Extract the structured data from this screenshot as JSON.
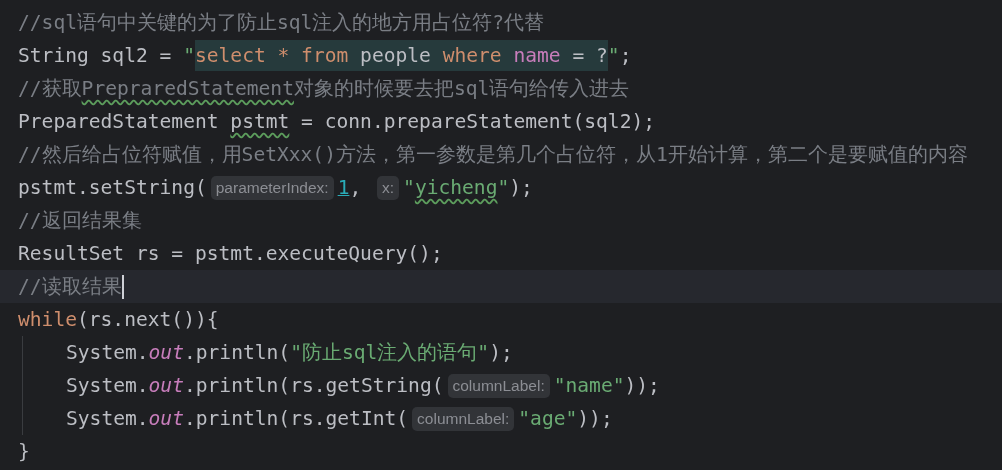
{
  "editor": {
    "lines": [
      {
        "current": false,
        "tokens": [
          {
            "kind": "comment",
            "text": "//sql语句中关键的为了防止sql注入的地方用占位符?代替"
          }
        ]
      },
      {
        "current": false,
        "tokens": [
          {
            "kind": "plain",
            "text": "String sql2 = "
          },
          {
            "kind": "string",
            "text": "\""
          },
          {
            "kind": "sql-keyword",
            "text": "select * from"
          },
          {
            "kind": "sql-plain",
            "text": " people "
          },
          {
            "kind": "sql-keyword",
            "text": "where "
          },
          {
            "kind": "sql-column",
            "text": "name"
          },
          {
            "kind": "sql-plain",
            "text": " = ?"
          },
          {
            "kind": "string",
            "text": "\""
          },
          {
            "kind": "plain",
            "text": ";"
          }
        ]
      },
      {
        "current": false,
        "tokens": [
          {
            "kind": "comment",
            "text": "//获取"
          },
          {
            "kind": "comment",
            "text": "PrepraredStatement",
            "typo": true
          },
          {
            "kind": "comment",
            "text": "对象的时候要去把sql语句给传入进去"
          }
        ]
      },
      {
        "current": false,
        "tokens": [
          {
            "kind": "plain",
            "text": "PreparedStatement "
          },
          {
            "kind": "plain",
            "text": "pstmt",
            "typo": true
          },
          {
            "kind": "plain",
            "text": " = conn.prepareStatement(sql2);"
          }
        ]
      },
      {
        "current": false,
        "tokens": [
          {
            "kind": "comment",
            "text": "//然后给占位符赋值，用SetXxx()方法，第一参数是第几个占位符，从1开始计算，第二个是要赋值的内容"
          }
        ]
      },
      {
        "current": false,
        "tokens": [
          {
            "kind": "plain",
            "text": "pstmt.setString("
          },
          {
            "kind": "hint",
            "text": "parameterIndex:"
          },
          {
            "kind": "number",
            "text": "1"
          },
          {
            "kind": "plain",
            "text": ", "
          },
          {
            "kind": "hint",
            "text": "x:"
          },
          {
            "kind": "string",
            "text": "\""
          },
          {
            "kind": "string",
            "text": "yicheng",
            "typo": true
          },
          {
            "kind": "string",
            "text": "\""
          },
          {
            "kind": "plain",
            "text": ");"
          }
        ]
      },
      {
        "current": false,
        "tokens": [
          {
            "kind": "comment",
            "text": "//返回结果集"
          }
        ]
      },
      {
        "current": false,
        "tokens": [
          {
            "kind": "plain",
            "text": "ResultSet rs = pstmt.executeQuery();"
          }
        ]
      },
      {
        "current": true,
        "tokens": [
          {
            "kind": "comment",
            "text": "//读取结果"
          }
        ]
      },
      {
        "current": false,
        "tokens": [
          {
            "kind": "keyword",
            "text": "while"
          },
          {
            "kind": "plain",
            "text": "(rs.next()){"
          }
        ],
        "children": [
          {
            "current": false,
            "tokens": [
              {
                "kind": "plain",
                "text": "System."
              },
              {
                "kind": "field",
                "text": "out"
              },
              {
                "kind": "plain",
                "text": ".println("
              },
              {
                "kind": "string",
                "text": "\"防止sql注入的语句\""
              },
              {
                "kind": "plain",
                "text": ");"
              }
            ]
          },
          {
            "current": false,
            "tokens": [
              {
                "kind": "plain",
                "text": "System."
              },
              {
                "kind": "field",
                "text": "out"
              },
              {
                "kind": "plain",
                "text": ".println(rs.getString("
              },
              {
                "kind": "hint",
                "text": "columnLabel:"
              },
              {
                "kind": "string",
                "text": "\"name\""
              },
              {
                "kind": "plain",
                "text": "));"
              }
            ]
          },
          {
            "current": false,
            "tokens": [
              {
                "kind": "plain",
                "text": "System."
              },
              {
                "kind": "field",
                "text": "out"
              },
              {
                "kind": "plain",
                "text": ".println(rs.getInt("
              },
              {
                "kind": "hint",
                "text": "columnLabel:"
              },
              {
                "kind": "string",
                "text": "\"age\""
              },
              {
                "kind": "plain",
                "text": "));"
              }
            ]
          }
        ]
      },
      {
        "current": false,
        "tokens": [
          {
            "kind": "plain",
            "text": "}"
          }
        ]
      }
    ]
  }
}
